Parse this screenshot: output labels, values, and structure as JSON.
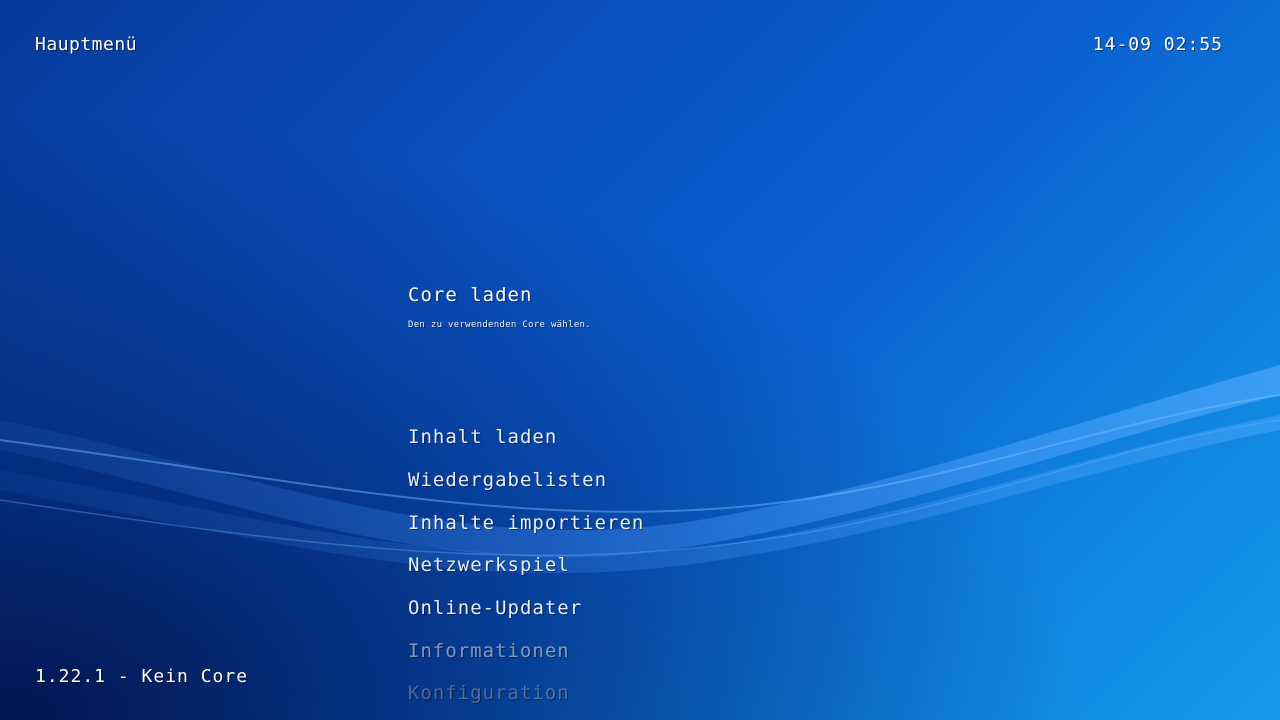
{
  "header": {
    "title": "Hauptmenü",
    "clock": "14-09 02:55"
  },
  "footer": {
    "version": "1.22.1 - Kein Core"
  },
  "menu": {
    "selected": {
      "label": "Core laden",
      "description": "Den zu verwendenden Core wählen."
    },
    "items": [
      {
        "label": "Inhalt laden"
      },
      {
        "label": "Wiedergabelisten"
      },
      {
        "label": "Inhalte importieren"
      },
      {
        "label": "Netzwerkspiel"
      },
      {
        "label": "Online-Updater"
      },
      {
        "label": "Informationen"
      },
      {
        "label": "Konfiguration"
      }
    ]
  },
  "theme": {
    "background_top": "#073a9a",
    "background_bottom_right": "#1699ec",
    "text_color": "#ffffff"
  }
}
